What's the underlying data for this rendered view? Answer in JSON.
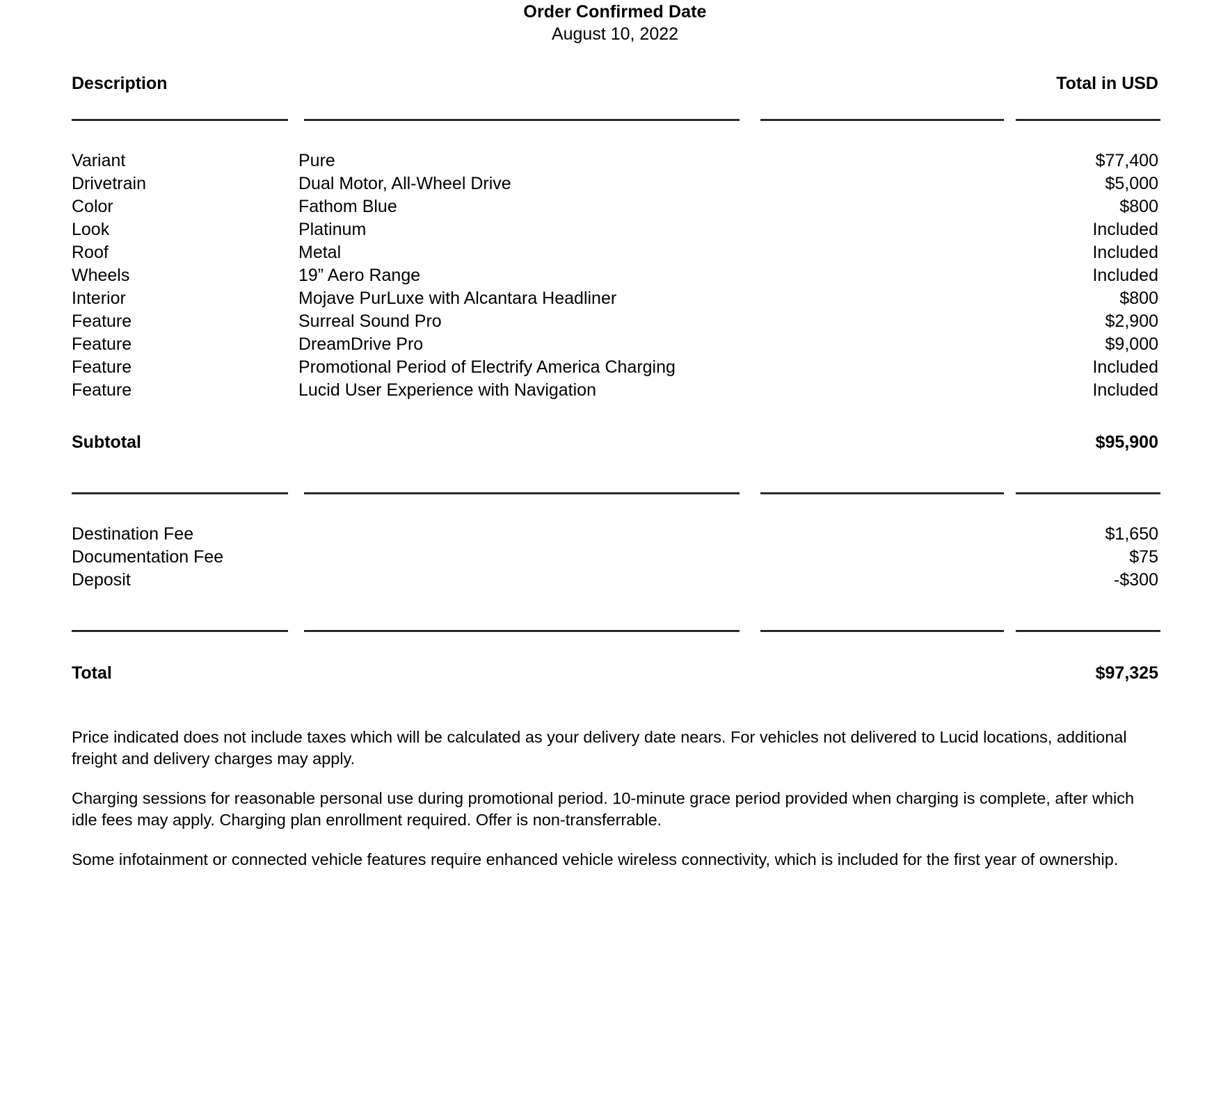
{
  "header": {
    "title": "Order Confirmed Date",
    "date": "August 10, 2022"
  },
  "table": {
    "columns": {
      "description": "Description",
      "total": "Total in USD"
    },
    "rows": [
      {
        "label": "Variant",
        "value": "Pure",
        "price": "$77,400"
      },
      {
        "label": "Drivetrain",
        "value": "Dual Motor, All-Wheel Drive",
        "price": "$5,000"
      },
      {
        "label": "Color",
        "value": "Fathom Blue",
        "price": "$800"
      },
      {
        "label": "Look",
        "value": "Platinum",
        "price": "Included"
      },
      {
        "label": "Roof",
        "value": "Metal",
        "price": "Included"
      },
      {
        "label": "Wheels",
        "value": "19” Aero Range",
        "price": "Included"
      },
      {
        "label": "Interior",
        "value": "Mojave PurLuxe with Alcantara Headliner",
        "price": "$800"
      },
      {
        "label": "Feature",
        "value": "Surreal Sound Pro",
        "price": "$2,900"
      },
      {
        "label": "Feature",
        "value": "DreamDrive Pro",
        "price": "$9,000"
      },
      {
        "label": "Feature",
        "value": "Promotional Period of Electrify America Charging",
        "price": "Included"
      },
      {
        "label": "Feature",
        "value": "Lucid User Experience with Navigation",
        "price": "Included"
      }
    ]
  },
  "subtotal": {
    "label": "Subtotal",
    "value": "$95,900"
  },
  "fees": [
    {
      "label": "Destination Fee",
      "value": "$1,650"
    },
    {
      "label": "Documentation Fee",
      "value": "$75"
    },
    {
      "label": "Deposit",
      "value": "-$300"
    }
  ],
  "total": {
    "label": "Total",
    "value": "$97,325"
  },
  "notes": [
    "Price indicated does not include taxes which will be calculated as your delivery date nears. For vehicles not delivered to Lucid locations, additional freight and delivery charges may apply.",
    "Charging sessions for reasonable personal use during promotional period. 10-minute grace period provided when charging is complete, after which idle fees may apply. Charging plan enrollment required. Offer is non-transferrable.",
    "Some infotainment or connected vehicle features require enhanced vehicle wireless connectivity, which is included for the first year of ownership."
  ],
  "colors": {
    "text": "#000000",
    "rule": "#2b2b2b",
    "background": "#ffffff"
  }
}
